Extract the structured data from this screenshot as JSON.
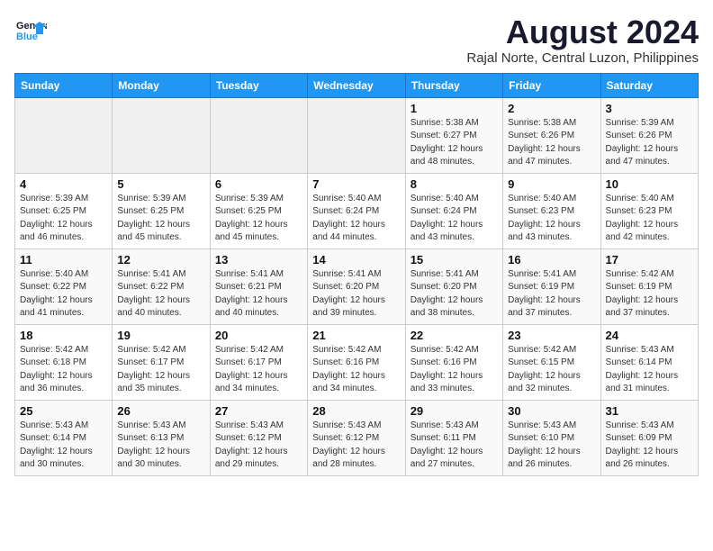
{
  "header": {
    "logo_line1": "General",
    "logo_line2": "Blue",
    "title": "August 2024",
    "subtitle": "Rajal Norte, Central Luzon, Philippines"
  },
  "weekdays": [
    "Sunday",
    "Monday",
    "Tuesday",
    "Wednesday",
    "Thursday",
    "Friday",
    "Saturday"
  ],
  "weeks": [
    [
      {
        "day": "",
        "info": ""
      },
      {
        "day": "",
        "info": ""
      },
      {
        "day": "",
        "info": ""
      },
      {
        "day": "",
        "info": ""
      },
      {
        "day": "1",
        "info": "Sunrise: 5:38 AM\nSunset: 6:27 PM\nDaylight: 12 hours\nand 48 minutes."
      },
      {
        "day": "2",
        "info": "Sunrise: 5:38 AM\nSunset: 6:26 PM\nDaylight: 12 hours\nand 47 minutes."
      },
      {
        "day": "3",
        "info": "Sunrise: 5:39 AM\nSunset: 6:26 PM\nDaylight: 12 hours\nand 47 minutes."
      }
    ],
    [
      {
        "day": "4",
        "info": "Sunrise: 5:39 AM\nSunset: 6:25 PM\nDaylight: 12 hours\nand 46 minutes."
      },
      {
        "day": "5",
        "info": "Sunrise: 5:39 AM\nSunset: 6:25 PM\nDaylight: 12 hours\nand 45 minutes."
      },
      {
        "day": "6",
        "info": "Sunrise: 5:39 AM\nSunset: 6:25 PM\nDaylight: 12 hours\nand 45 minutes."
      },
      {
        "day": "7",
        "info": "Sunrise: 5:40 AM\nSunset: 6:24 PM\nDaylight: 12 hours\nand 44 minutes."
      },
      {
        "day": "8",
        "info": "Sunrise: 5:40 AM\nSunset: 6:24 PM\nDaylight: 12 hours\nand 43 minutes."
      },
      {
        "day": "9",
        "info": "Sunrise: 5:40 AM\nSunset: 6:23 PM\nDaylight: 12 hours\nand 43 minutes."
      },
      {
        "day": "10",
        "info": "Sunrise: 5:40 AM\nSunset: 6:23 PM\nDaylight: 12 hours\nand 42 minutes."
      }
    ],
    [
      {
        "day": "11",
        "info": "Sunrise: 5:40 AM\nSunset: 6:22 PM\nDaylight: 12 hours\nand 41 minutes."
      },
      {
        "day": "12",
        "info": "Sunrise: 5:41 AM\nSunset: 6:22 PM\nDaylight: 12 hours\nand 40 minutes."
      },
      {
        "day": "13",
        "info": "Sunrise: 5:41 AM\nSunset: 6:21 PM\nDaylight: 12 hours\nand 40 minutes."
      },
      {
        "day": "14",
        "info": "Sunrise: 5:41 AM\nSunset: 6:20 PM\nDaylight: 12 hours\nand 39 minutes."
      },
      {
        "day": "15",
        "info": "Sunrise: 5:41 AM\nSunset: 6:20 PM\nDaylight: 12 hours\nand 38 minutes."
      },
      {
        "day": "16",
        "info": "Sunrise: 5:41 AM\nSunset: 6:19 PM\nDaylight: 12 hours\nand 37 minutes."
      },
      {
        "day": "17",
        "info": "Sunrise: 5:42 AM\nSunset: 6:19 PM\nDaylight: 12 hours\nand 37 minutes."
      }
    ],
    [
      {
        "day": "18",
        "info": "Sunrise: 5:42 AM\nSunset: 6:18 PM\nDaylight: 12 hours\nand 36 minutes."
      },
      {
        "day": "19",
        "info": "Sunrise: 5:42 AM\nSunset: 6:17 PM\nDaylight: 12 hours\nand 35 minutes."
      },
      {
        "day": "20",
        "info": "Sunrise: 5:42 AM\nSunset: 6:17 PM\nDaylight: 12 hours\nand 34 minutes."
      },
      {
        "day": "21",
        "info": "Sunrise: 5:42 AM\nSunset: 6:16 PM\nDaylight: 12 hours\nand 34 minutes."
      },
      {
        "day": "22",
        "info": "Sunrise: 5:42 AM\nSunset: 6:16 PM\nDaylight: 12 hours\nand 33 minutes."
      },
      {
        "day": "23",
        "info": "Sunrise: 5:42 AM\nSunset: 6:15 PM\nDaylight: 12 hours\nand 32 minutes."
      },
      {
        "day": "24",
        "info": "Sunrise: 5:43 AM\nSunset: 6:14 PM\nDaylight: 12 hours\nand 31 minutes."
      }
    ],
    [
      {
        "day": "25",
        "info": "Sunrise: 5:43 AM\nSunset: 6:14 PM\nDaylight: 12 hours\nand 30 minutes."
      },
      {
        "day": "26",
        "info": "Sunrise: 5:43 AM\nSunset: 6:13 PM\nDaylight: 12 hours\nand 30 minutes."
      },
      {
        "day": "27",
        "info": "Sunrise: 5:43 AM\nSunset: 6:12 PM\nDaylight: 12 hours\nand 29 minutes."
      },
      {
        "day": "28",
        "info": "Sunrise: 5:43 AM\nSunset: 6:12 PM\nDaylight: 12 hours\nand 28 minutes."
      },
      {
        "day": "29",
        "info": "Sunrise: 5:43 AM\nSunset: 6:11 PM\nDaylight: 12 hours\nand 27 minutes."
      },
      {
        "day": "30",
        "info": "Sunrise: 5:43 AM\nSunset: 6:10 PM\nDaylight: 12 hours\nand 26 minutes."
      },
      {
        "day": "31",
        "info": "Sunrise: 5:43 AM\nSunset: 6:09 PM\nDaylight: 12 hours\nand 26 minutes."
      }
    ]
  ]
}
